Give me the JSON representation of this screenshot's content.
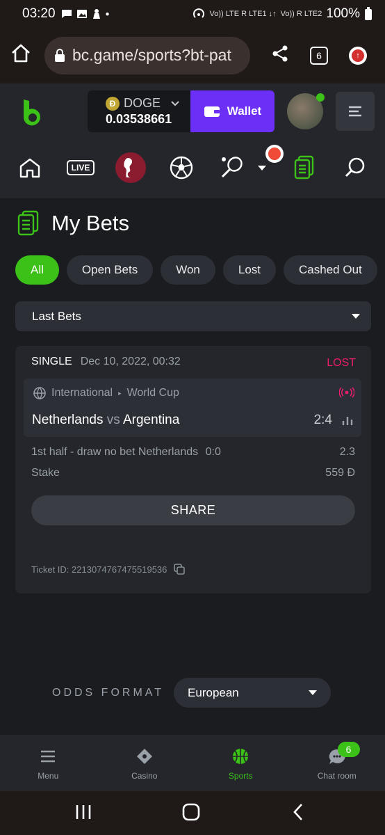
{
  "status_bar": {
    "time": "03:20",
    "network1": "Vo)) LTE R LTE1 ↓↑",
    "network2": "Vo)) R LTE2",
    "battery": "100%"
  },
  "browser": {
    "url": "bc.game/sports?bt-pat",
    "tab_count": "6"
  },
  "header": {
    "currency": "DOGE",
    "balance": "0.03538661",
    "wallet_label": "Wallet"
  },
  "sports_nav": {
    "live_label": "LIVE"
  },
  "page": {
    "title": "My Bets"
  },
  "filters": [
    "All",
    "Open Bets",
    "Won",
    "Lost",
    "Cashed Out"
  ],
  "period_select": {
    "value": "Last Bets"
  },
  "bet": {
    "type": "SINGLE",
    "date": "Dec 10, 2022, 00:32",
    "status": "LOST",
    "category": "International",
    "tournament": "World Cup",
    "home": "Netherlands",
    "vs": "vs",
    "away": "Argentina",
    "score": "2:4",
    "market": "1st half - draw no bet Netherlands",
    "market_score": "0:0",
    "odds": "2.3",
    "stake_label": "Stake",
    "stake": "559 Đ",
    "share_label": "SHARE",
    "ticket": "Ticket ID: 221307476747551953​6"
  },
  "odds_format": {
    "label": "ODDS FORMAT",
    "value": "European"
  },
  "tabbar": {
    "menu": "Menu",
    "casino": "Casino",
    "sports": "Sports",
    "chat": "Chat room",
    "chat_count": "6"
  },
  "colors": {
    "accent_green": "#3bc117",
    "wallet_purple": "#6b2ff5",
    "lost_pink": "#ed1d6d",
    "bg": "#1a1c20",
    "panel": "#24262b"
  }
}
